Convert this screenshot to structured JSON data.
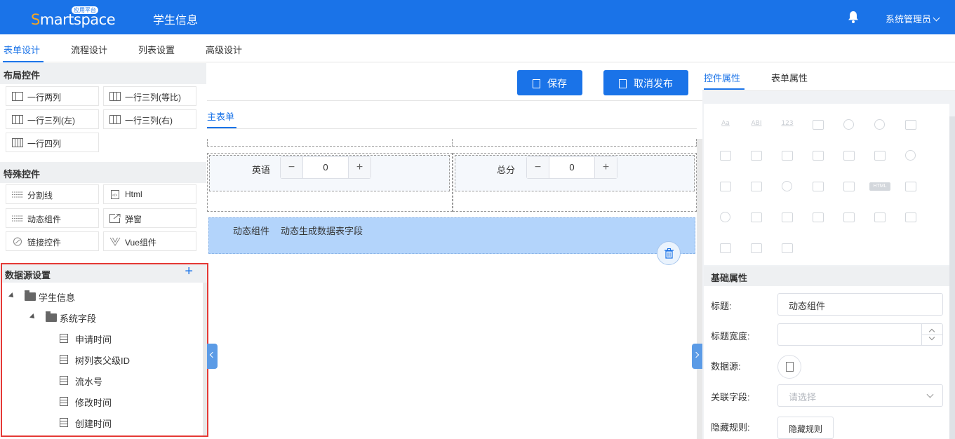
{
  "header": {
    "logo_text_s": "S",
    "logo_text_rest": "martspace",
    "logo_badge": "应用平台",
    "title": "学生信息",
    "user": "系统管理员",
    "bell_icon": "bell-icon"
  },
  "tabs": [
    {
      "label": "表单设计",
      "active": true
    },
    {
      "label": "流程设计"
    },
    {
      "label": "列表设置"
    },
    {
      "label": "高级设计"
    }
  ],
  "left": {
    "layout_title": "布局控件",
    "layout_items": [
      "一行两列",
      "一行三列(等比)",
      "一行三列(左)",
      "一行三列(右)",
      "一行四列"
    ],
    "special_title": "特殊控件",
    "special_items": [
      "分割线",
      "Html",
      "动态组件",
      "弹窗",
      "链接控件",
      "Vue组件"
    ],
    "datasource": {
      "title": "数据源设置",
      "root": "学生信息",
      "group": "系统字段",
      "fields": [
        "申请时间",
        "树列表父级ID",
        "流水号",
        "修改时间",
        "创建时间"
      ]
    }
  },
  "center": {
    "save": "保存",
    "unpublish": "取消发布",
    "subtab": "主表单",
    "field1_label": "英语",
    "field1_value": "0",
    "field2_label": "总分",
    "field2_value": "0",
    "minus": "−",
    "plus": "+",
    "dynamic_label": "动态组件",
    "dynamic_text": "动态生成数据表字段"
  },
  "right": {
    "tabs": [
      "控件属性",
      "表单属性"
    ],
    "basic_title": "基础属性",
    "title_label": "标题:",
    "title_value": "动态组件",
    "title_width_label": "标题宽度:",
    "datasource_label": "数据源:",
    "related_field_label": "关联字段:",
    "related_field_placeholder": "请选择",
    "hide_rule_label": "隐藏规则:",
    "hide_rule_button": "隐藏规则",
    "html_badge": "HTML",
    "text_icons": [
      "Aa",
      "ABI",
      "123"
    ]
  },
  "colors": {
    "primary": "#1a73e8",
    "selected_block": "#b3d4fb",
    "highlight_border": "#e53935"
  }
}
